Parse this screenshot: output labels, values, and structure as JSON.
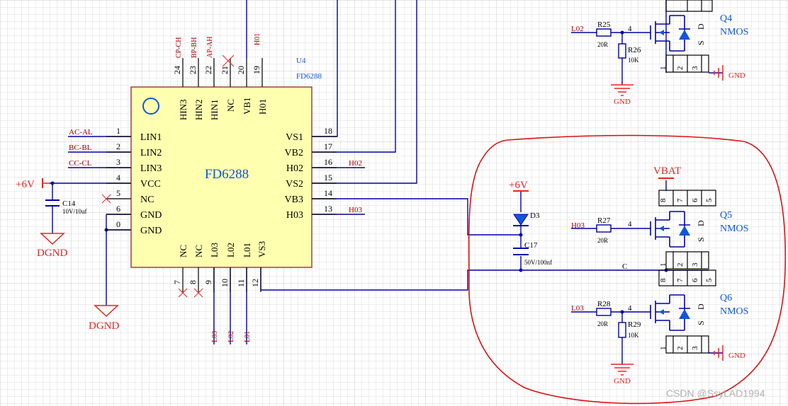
{
  "u4": {
    "ref": "U4",
    "part": "FD6288",
    "center_label": "FD6288",
    "top_pin_numbers": [
      "24",
      "23",
      "22",
      "21",
      "20",
      "19"
    ],
    "top_pin_names": [
      "HIN3",
      "HIN2",
      "HIN1",
      "NC",
      "VB1",
      "H01"
    ],
    "top_net_labels": [
      "CP-CH",
      "BP-BH",
      "AP-AH",
      "H01"
    ],
    "left_pin_numbers": [
      "1",
      "2",
      "3",
      "4",
      "5",
      "6",
      "0"
    ],
    "left_pin_names": [
      "LIN1",
      "LIN2",
      "LIN3",
      "VCC",
      "NC",
      "GND",
      "GND"
    ],
    "left_net_labels": [
      "AC-AL",
      "BC-BL",
      "CC-CL"
    ],
    "right_pin_numbers": [
      "18",
      "17",
      "16",
      "15",
      "14",
      "13"
    ],
    "right_pin_names": [
      "VS1",
      "VB2",
      "H02",
      "VS2",
      "VB3",
      "H03"
    ],
    "right_net_labels": [
      "H02",
      "H03"
    ],
    "bottom_pin_numbers": [
      "7",
      "8",
      "9",
      "10",
      "11",
      "12"
    ],
    "bottom_pin_names": [
      "NC",
      "NC",
      "L03",
      "L02",
      "L01",
      "VS3"
    ],
    "bottom_net_labels": [
      "L03",
      "L02",
      "L01"
    ]
  },
  "power": {
    "plus6v_left": "+6V",
    "plus6v_diode": "+6V",
    "vbat": "VBAT",
    "dgnd_1": "DGND",
    "dgnd_2": "DGND",
    "gnd_q4_r": "GND",
    "gnd_q4_b": "GND",
    "gnd_q6_r": "GND",
    "gnd_q6_b": "GND"
  },
  "c14": {
    "ref": "C14",
    "value": "10V/10uf"
  },
  "d3": {
    "ref": "D3"
  },
  "c17": {
    "ref": "C17",
    "value": "50V/100nf"
  },
  "net_c": "C",
  "q4": {
    "ref": "Q4",
    "type": "NMOS",
    "gate_net": "L02",
    "gate_pin": "4",
    "rg_ref": "R25",
    "rg_val": "20R",
    "rp_ref": "R26",
    "rp_val": "10K",
    "pins_top": [
      "",
      "",
      ""
    ],
    "pins_bot": [
      "1",
      "2",
      "3"
    ],
    "sd": [
      "S",
      "D"
    ]
  },
  "q5": {
    "ref": "Q5",
    "type": "NMOS",
    "gate_net": "H03",
    "gate_pin": "4",
    "rg_ref": "R27",
    "rg_val": "20R",
    "pins_top": [
      "8",
      "7",
      "6",
      "5"
    ],
    "pins_bot": [
      "1",
      "2",
      "3"
    ],
    "sd": [
      "S",
      "D"
    ]
  },
  "q6": {
    "ref": "Q6",
    "type": "NMOS",
    "gate_net": "L03",
    "gate_pin": "4",
    "rg_ref": "R28",
    "rg_val": "20R",
    "rp_ref": "R29",
    "rp_val": "10K",
    "pins_top": [
      "8",
      "7",
      "6",
      "5"
    ],
    "pins_bot": [
      "1",
      "2",
      "3"
    ],
    "sd": [
      "S",
      "D"
    ]
  },
  "watermark": "CSDN @SsyLAD1994",
  "colors": {
    "wire": "#0000aa",
    "ic_body": "#ffffb0",
    "ic_border": "#a04040",
    "part_blue": "#1155dd",
    "net_red": "#aa0000",
    "power_red": "#ee2222",
    "grid": "#d9d9d9",
    "highlight": "#dd1111"
  }
}
